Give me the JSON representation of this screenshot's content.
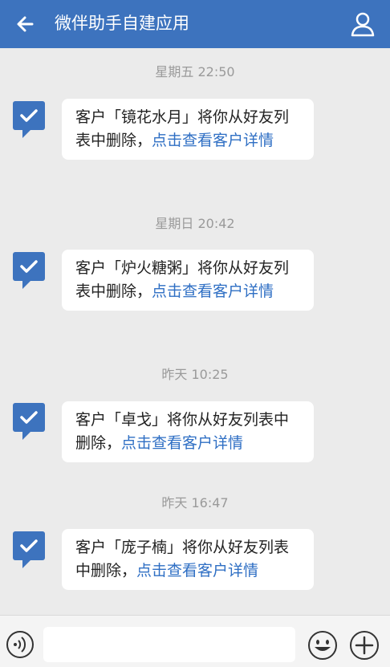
{
  "header": {
    "title": "微伴助手自建应用",
    "back_icon": "arrow-left-icon",
    "profile_icon": "user-icon"
  },
  "messages": [
    {
      "time": "星期五  22:50",
      "text_prefix": "客户「镜花水月」将你从好友列表中删除，",
      "link_text": "点击查看客户详情",
      "avatar_icon": "check-icon"
    },
    {
      "time": "星期日  20:42",
      "text_prefix": "客户「炉火糖粥」将你从好友列表中删除，",
      "link_text": "点击查看客户详情",
      "avatar_icon": "check-icon"
    },
    {
      "time": "昨天  10:25",
      "text_prefix": "客户「卓戈」将你从好友列表中删除，",
      "link_text": "点击查看客户详情",
      "avatar_icon": "check-icon"
    },
    {
      "time": "昨天  16:47",
      "text_prefix": "客户「庞子楠」将你从好友列表中删除，",
      "link_text": "点击查看客户详情",
      "avatar_icon": "check-icon"
    }
  ],
  "footer": {
    "input_value": "",
    "voice_icon": "voice-icon",
    "emoji_icon": "emoji-icon",
    "plus_icon": "plus-icon"
  },
  "colors": {
    "header_bg": "#3d73be",
    "link": "#2f6fc4",
    "background": "#ebebeb"
  }
}
